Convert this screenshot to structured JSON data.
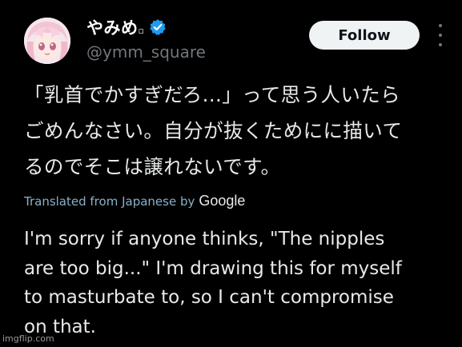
{
  "author": {
    "display_name": "やみめ",
    "name_glyph": "▫",
    "handle": "@ymm_square",
    "verified": true,
    "avatar_icon": "anime-avatar-icon"
  },
  "actions": {
    "follow_label": "Follow",
    "more_icon": "more-vertical-icon"
  },
  "tweet": {
    "text_lines": [
      "「乳首でかすぎだろ...」って思う人いたら",
      "ごめんなさい。自分が抜くためにに描いて",
      "るのでそこは譲れないです。"
    ],
    "translation_label": "Translated from Japanese by",
    "translation_provider": "Google",
    "translated_lines": [
      "I'm sorry if anyone thinks, \"The nipples",
      "are too big...\" I'm drawing this for myself",
      "to masturbate to, so I can't compromise",
      "on that."
    ]
  },
  "watermark": "imgflip.com",
  "colors": {
    "background": "#000000",
    "text": "#e7e9ea",
    "muted": "#71767b",
    "verified": "#1d9bf0",
    "translation_link": "#8ab0c8",
    "follow_bg": "#eff3f4"
  }
}
